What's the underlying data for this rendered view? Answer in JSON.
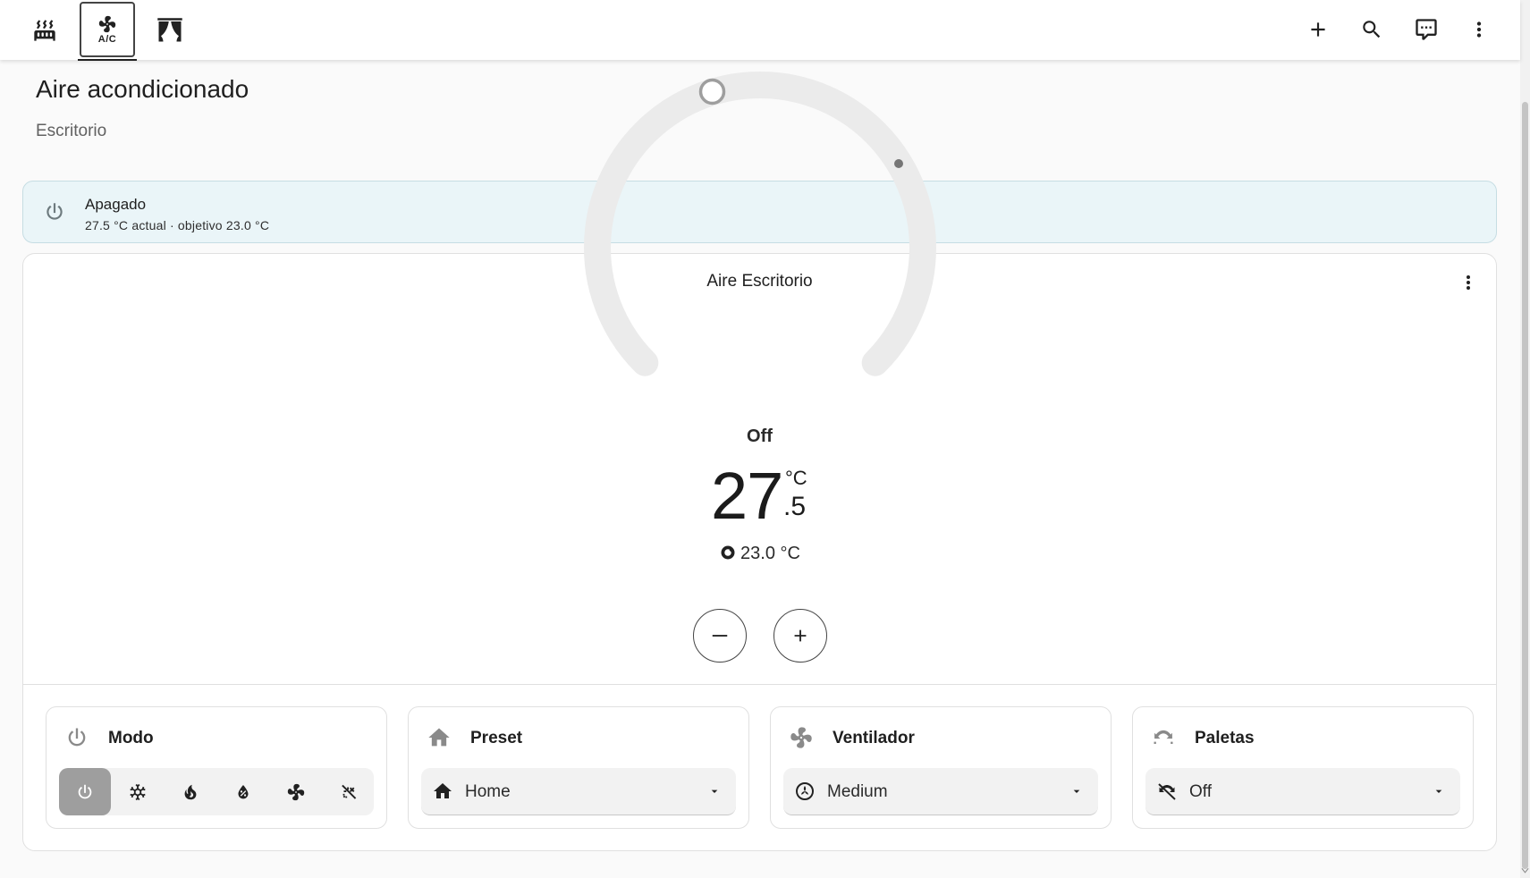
{
  "header": {
    "tabs": [
      {
        "icon": "radiator-icon"
      },
      {
        "icon": "air-conditioner-icon",
        "label": "A/C",
        "active": true
      },
      {
        "icon": "curtains-icon"
      }
    ],
    "actions": [
      "add-icon",
      "search-icon",
      "assist-icon",
      "more-vert-icon"
    ]
  },
  "page": {
    "title": "Aire acondicionado",
    "subtitle": "Escritorio"
  },
  "status": {
    "title": "Apagado",
    "detail": "27.5 °C actual · objetivo 23.0 °C",
    "icon": "power-icon"
  },
  "thermostat": {
    "name": "Aire Escritorio",
    "mode": "Off",
    "current_integer": "27",
    "current_decimal": ".5",
    "unit": "°C",
    "target": "23.0 °C",
    "current_value": 27.5,
    "target_value": 23.0
  },
  "features": {
    "mode": {
      "title": "Modo",
      "options": [
        "power-icon",
        "snowflake-icon",
        "fire-icon",
        "water-percent-icon",
        "fan-icon",
        "sun-snowflake-icon"
      ],
      "selected": 0
    },
    "preset": {
      "title": "Preset",
      "value": "Home"
    },
    "fan": {
      "title": "Ventilador",
      "value": "Medium"
    },
    "swing": {
      "title": "Paletas",
      "value": "Off"
    }
  },
  "colors": {
    "status_bg": "#eaf5f8",
    "active_mode": "#9e9e9e",
    "arc_track": "#ebebeb"
  }
}
